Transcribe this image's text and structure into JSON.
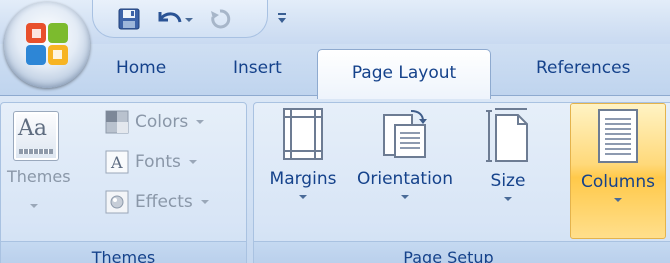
{
  "tabs": {
    "home": "Home",
    "insert": "Insert",
    "page_layout": "Page Layout",
    "references": "References"
  },
  "themes_group": {
    "label": "Themes",
    "themes_button": "Themes",
    "colors": "Colors",
    "fonts": "Fonts",
    "effects": "Effects"
  },
  "page_setup_group": {
    "label": "Page Setup",
    "margins": "Margins",
    "orientation": "Orientation",
    "size": "Size",
    "columns": "Columns"
  },
  "colors": {
    "text": "#15428b",
    "disabled_text": "#8a97a8",
    "highlight": "#ffd97a"
  },
  "icons": [
    "office-button-icon",
    "save-icon",
    "undo-icon",
    "redo-icon",
    "customize-qat-icon",
    "themes-icon",
    "colors-icon",
    "fonts-icon",
    "effects-icon",
    "margins-icon",
    "orientation-icon",
    "size-icon",
    "columns-icon"
  ]
}
